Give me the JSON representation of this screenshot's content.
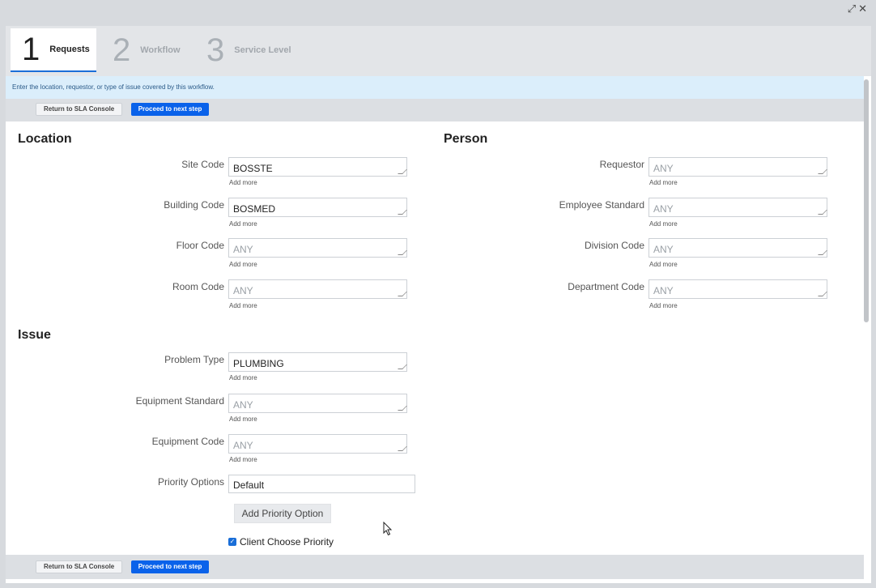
{
  "window": {
    "expand_icon": "expand-icon",
    "close_icon": "close-icon"
  },
  "tabs": [
    {
      "num": "1",
      "label": "Requests",
      "active": true
    },
    {
      "num": "2",
      "label": "Workflow",
      "active": false
    },
    {
      "num": "3",
      "label": "Service Level",
      "active": false
    }
  ],
  "info": "Enter the location, requestor, or type of issue covered by this workflow.",
  "buttons": {
    "return": "Return to SLA Console",
    "proceed": "Proceed to next step"
  },
  "location": {
    "title": "Location",
    "fields": [
      {
        "label": "Site Code",
        "value": "BOSSTE",
        "add": "Add more"
      },
      {
        "label": "Building Code",
        "value": "BOSMED",
        "add": "Add more"
      },
      {
        "label": "Floor Code",
        "value": "ANY",
        "add": "Add more"
      },
      {
        "label": "Room Code",
        "value": "ANY",
        "add": "Add more"
      }
    ]
  },
  "person": {
    "title": "Person",
    "fields": [
      {
        "label": "Requestor",
        "value": "ANY",
        "add": "Add more"
      },
      {
        "label": "Employee Standard",
        "value": "ANY",
        "add": "Add more"
      },
      {
        "label": "Division Code",
        "value": "ANY",
        "add": "Add more"
      },
      {
        "label": "Department Code",
        "value": "ANY",
        "add": "Add more"
      }
    ]
  },
  "issue": {
    "title": "Issue",
    "fields": [
      {
        "label": "Problem Type",
        "value": "PLUMBING",
        "add": "Add more"
      },
      {
        "label": "Equipment Standard",
        "value": "ANY",
        "add": "Add more"
      },
      {
        "label": "Equipment Code",
        "value": "ANY",
        "add": "Add more"
      }
    ],
    "priority_label": "Priority Options",
    "priority_value": "Default",
    "add_priority": "Add Priority Option",
    "client_choose": "Client Choose Priority",
    "client_choose_checked": true
  },
  "colors": {
    "primary": "#0a62ea",
    "info_bg": "#dbeefb",
    "tab_underline": "#1a6ed8"
  }
}
